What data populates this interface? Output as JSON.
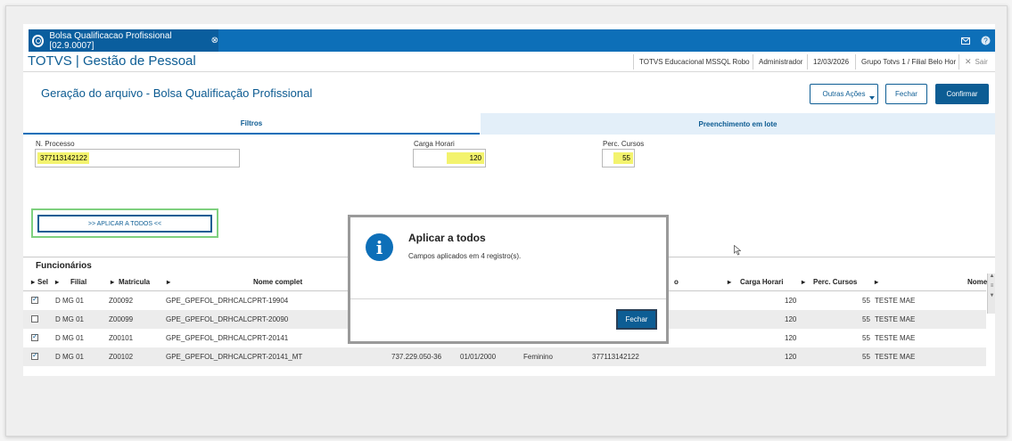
{
  "window": {
    "tab_title": "Bolsa Qualificacao Profissional [02.9.0007]",
    "tab_close": "⊗",
    "mail_icon": "mail-icon",
    "help_icon": "help-icon"
  },
  "header": {
    "app_title": "TOTVS | Gestão de Pessoal",
    "environment": "TOTVS Educacional MSSQL Robo",
    "user": "Administrador",
    "date": "12/03/2026",
    "branch": "Grupo Totvs 1 / Filial Belo Hor",
    "exit": "Sair"
  },
  "page": {
    "title": "Geração do arquivo - Bolsa Qualificação Profissional",
    "actions": {
      "outras_acoes": "Outras Ações",
      "fechar": "Fechar",
      "confirmar": "Confirmar"
    }
  },
  "tabs": [
    {
      "label": "Filtros"
    },
    {
      "label": "Preenchimento em lote"
    }
  ],
  "form": {
    "processo_label": "N. Processo",
    "processo_value": "377113142122",
    "carga_label": "Carga Horari",
    "carga_value": "120",
    "perc_label": "Perc. Cursos",
    "perc_value": "55",
    "apply_button": ">> APLICAR A TODOS <<"
  },
  "grid": {
    "title": "Funcionários",
    "headers": {
      "sel": "Sel",
      "filial": "Filial",
      "matricula": "Matricula",
      "nome": "Nome complet",
      "o": "o",
      "carga": "Carga Horari",
      "perc": "Perc. Cursos",
      "nome2": "Nome"
    },
    "rows": [
      {
        "checked": true,
        "filial": "D MG 01",
        "matricula": "Z00092",
        "nome": "GPE_GPEFOL_DRHCALCPRT-19904",
        "cpf": "",
        "data": "",
        "sexo": "",
        "processo": "",
        "carga": "120",
        "perc": "55",
        "curso": "TESTE MAE"
      },
      {
        "checked": false,
        "filial": "D MG 01",
        "matricula": "Z00099",
        "nome": "GPE_GPEFOL_DRHCALCPRT-20090",
        "cpf": "",
        "data": "",
        "sexo": "",
        "processo": "",
        "carga": "120",
        "perc": "55",
        "curso": "TESTE MAE"
      },
      {
        "checked": true,
        "filial": "D MG 01",
        "matricula": "Z00101",
        "nome": "GPE_GPEFOL_DRHCALCPRT-20141",
        "cpf": "",
        "data": "",
        "sexo": "",
        "processo": "",
        "carga": "120",
        "perc": "55",
        "curso": "TESTE MAE"
      },
      {
        "checked": true,
        "filial": "D MG 01",
        "matricula": "Z00102",
        "nome": "GPE_GPEFOL_DRHCALCPRT-20141_MT",
        "cpf": "737.229.050-36",
        "data": "01/01/2000",
        "sexo": "Feminino",
        "processo": "377113142122",
        "carga": "120",
        "perc": "55",
        "curso": "TESTE MAE"
      }
    ]
  },
  "dialog": {
    "icon": "info-icon",
    "title": "Aplicar a todos",
    "message": "Campos aplicados em 4 registro(s).",
    "close": "Fechar"
  },
  "colors": {
    "brand_blue": "#0d6fb8",
    "dark_blue": "#0d5d94",
    "highlight": "#f3f36e",
    "focus_green": "#7ed07e"
  }
}
